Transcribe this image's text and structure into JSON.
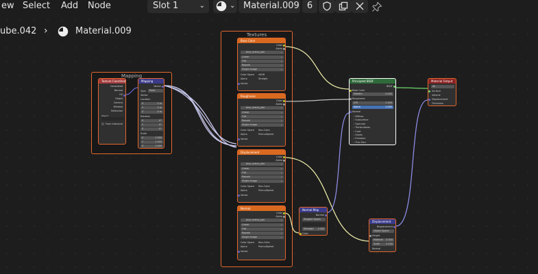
{
  "header": {
    "menu": [
      "ew",
      "Select",
      "Add",
      "Node"
    ],
    "slot": "Slot 1",
    "material_name": "Material.009",
    "user_count": "6"
  },
  "breadcrumb": {
    "object": "ube.042",
    "material": "Material.009"
  },
  "frames": {
    "textures": "Textures",
    "mapping": "Mapping"
  },
  "nodes": {
    "texcoord": {
      "title": "Texture Coordinate",
      "outputs": [
        "Generated",
        "Normal",
        "UV",
        "Object",
        "Camera",
        "Window",
        "Reflection"
      ],
      "object_label": "Object",
      "from_instancer": "From Instancer"
    },
    "mapping": {
      "title": "Mapping",
      "vector": "Vector",
      "type_label": "Type",
      "type_value": "Point",
      "vector_in": "Vector",
      "location": "Location",
      "rotation": "Rotation",
      "scale": "Scale",
      "loc": [
        "0 m",
        "0 m",
        "0 m"
      ],
      "rot": [
        "0°",
        "0°",
        "0°"
      ],
      "scl": [
        "1.000",
        "1.000",
        "1.000"
      ],
      "axes": [
        "X",
        "Y",
        "Z"
      ]
    },
    "base_color": {
      "title": "Base Color",
      "image": "blue_metal_plat",
      "cs_value": "sRGB"
    },
    "roughness": {
      "title": "Roughness",
      "image": "blue_metal_plat",
      "cs_value": "Non-Color"
    },
    "displacement_tex": {
      "title": "Displacement",
      "image": "blue_metal_plat",
      "cs_value": "Non-Color"
    },
    "normal_tex": {
      "title": "Normal",
      "image": "blue_metal_plat",
      "cs_value": "Non-Color"
    },
    "tex_common": {
      "color": "Color",
      "alpha": "Alpha",
      "linear": "Linear",
      "flat": "Flat",
      "repeat": "Repeat",
      "single_image": "Single Image",
      "color_space": "Color Space",
      "alpha_label": "Alpha",
      "alpha_value": "Straight",
      "vector": "Vector",
      "alpha_value2": "Premultiplied"
    },
    "bsdf": {
      "title": "Principled BSDF",
      "bsdf_out": "BSDF",
      "base_color": "Base Color",
      "metallic": "Metallic",
      "metallic_v": "0.000",
      "roughness": "Roughness",
      "ior": "IOR",
      "ior_v": "1.500",
      "alpha": "Alpha",
      "alpha_v": "1.000",
      "normal": "Normal",
      "panels": [
        "Diffuse",
        "Subsurface",
        "Specular",
        "Transmission",
        "Coat",
        "Sheen",
        "Emission",
        "Thin Film"
      ]
    },
    "output": {
      "title": "Material Output",
      "target": "All",
      "inputs": [
        "Surface",
        "Volume",
        "Displacement",
        "Thickness"
      ]
    },
    "normal_map": {
      "title": "Normal Map",
      "normal_out": "Normal",
      "space": "Tangent Space",
      "strength": "Strength",
      "strength_v": "1.000",
      "color": "Color"
    },
    "displacement": {
      "title": "Displacement",
      "out": "Displacement",
      "space": "Object Space",
      "height": "Height",
      "midlevel": "Midlevel",
      "midlevel_v": "0.500",
      "scale": "Scale",
      "scale_v": "0.100",
      "normal": "Normal"
    }
  },
  "colors": {
    "frame": "#e5682c",
    "tex_header": "#d9691f",
    "bsdf_header": "#2f6b3a",
    "output_header": "#8b2323",
    "vector_header": "#3b3b8a",
    "input_header": "#a33a3a"
  }
}
